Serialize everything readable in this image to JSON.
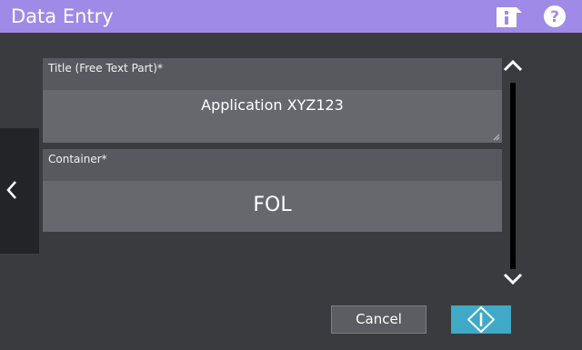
{
  "header": {
    "title": "Data Entry",
    "info_icon": "info-icon",
    "help_icon": "help-icon"
  },
  "nav": {
    "back_icon": "chevron-left-icon"
  },
  "fields": {
    "title": {
      "label": "Title (Free Text Part)*",
      "value": "Application XYZ123"
    },
    "container": {
      "label": "Container*",
      "value": "FOL"
    }
  },
  "scroll": {
    "up_icon": "chevron-up-icon",
    "down_icon": "chevron-down-icon"
  },
  "actions": {
    "cancel_label": "Cancel",
    "start_icon": "start-diamond-icon"
  },
  "colors": {
    "header_bg": "#a08ae8",
    "background": "#3a3b3e",
    "field_bg": "#67686e",
    "label_bg": "#58595f",
    "start_accent": "#3fa9c7"
  }
}
